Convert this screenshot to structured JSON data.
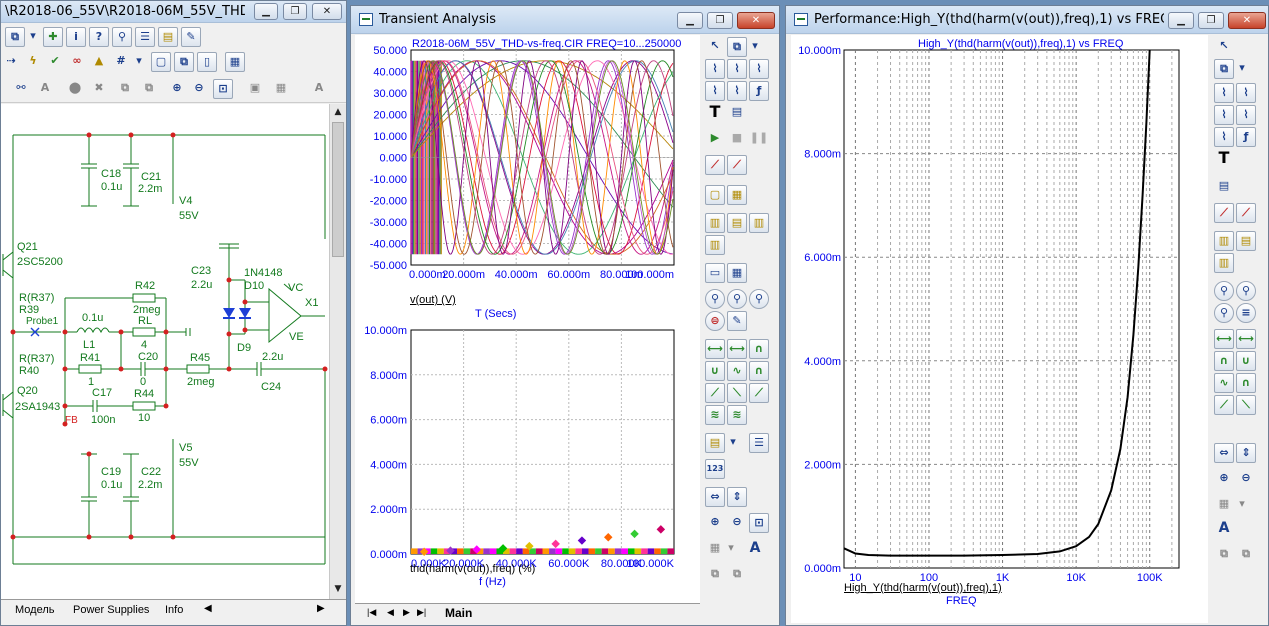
{
  "schematic": {
    "title": "\\R2018-06_55V\\R2018-06M_55V_THD-vs-fr...",
    "tabs": [
      "Модель",
      "Power Supplies",
      "Info"
    ],
    "labels": {
      "c18": "C18",
      "c18v": "0.1u",
      "c21": "C21",
      "c21v": "2.2m",
      "v4": "V4",
      "v4v": "55V",
      "q21": "Q21",
      "q21v": "2SC5200",
      "r42": "R42",
      "r42v": "2meg",
      "c23": "C23",
      "c23v": "2.2u",
      "d10n": "1N4148",
      "d10": "D10",
      "vc": "VC",
      "x1": "X1",
      "r37a": "R(R37)",
      "r39": "R39",
      "probe": "Probe1",
      "l1v": "0.1u",
      "l1": "L1",
      "rl": "RL",
      "rlv": "4",
      "d9": "D9",
      "ve": "VE",
      "r37b": "R(R37)",
      "r40": "R40",
      "r41": "R41",
      "r41v": "1",
      "c20": "C20",
      "c20v": "0",
      "r45": "R45",
      "r45v": "2meg",
      "c24v": "2.2u",
      "c24": "C24",
      "q20": "Q20",
      "q20v": "2SA1943",
      "c17": "C17",
      "c17v": "100n",
      "r44": "R44",
      "r44v": "10",
      "fb": "FB",
      "v5": "V5",
      "v5v": "55V",
      "c19": "C19",
      "c19v": "0.1u",
      "c22": "C22",
      "c22v": "2.2m"
    }
  },
  "transient": {
    "title": "Transient Analysis",
    "tab": "Main",
    "top_plot": {
      "heading": "R2018-06M_55V_THD-vs-freq.CIR FREQ=10...250000",
      "yticks": [
        "50.000",
        "40.000",
        "30.000",
        "20.000",
        "10.000",
        "0.000",
        "-10.000",
        "-20.000",
        "-30.000",
        "-40.000",
        "-50.000"
      ],
      "xticks": [
        "0.000m",
        "20.000m",
        "40.000m",
        "60.000m",
        "80.000m",
        "100.000m"
      ],
      "ylabel": "v(out) (V)",
      "xlabel": "T (Secs)"
    },
    "bottom_plot": {
      "yticks": [
        "10.000m",
        "8.000m",
        "6.000m",
        "4.000m",
        "2.000m",
        "0.000m"
      ],
      "xticks": [
        "0.000K",
        "20.000K",
        "40.000K",
        "60.000K",
        "80.000K",
        "100.000K"
      ],
      "ylabel": "thd(harm(v(out)),freq) (%)",
      "xlabel": "f (Hz)"
    }
  },
  "performance": {
    "title": "Performance:High_Y(thd(harm(v(out)),freq),1) vs FREQ",
    "heading": "High_Y(thd(harm(v(out)),freq),1) vs FREQ",
    "yticks": [
      "10.000m",
      "8.000m",
      "6.000m",
      "4.000m",
      "2.000m",
      "0.000m"
    ],
    "xticks": [
      "10",
      "100",
      "1K",
      "10K",
      "100K"
    ],
    "ylabel": "High_Y(thd(harm(v(out)),freq),1)",
    "xlabel": "FREQ"
  },
  "chart_data": [
    {
      "type": "line",
      "title": "R2018-06M_55V_THD-vs-freq.CIR FREQ=10...250000",
      "xlabel": "T (Secs)",
      "ylabel": "v(out) (V)",
      "xlim": [
        0,
        100
      ],
      "ylim": [
        -50,
        50
      ],
      "x_unit": "m",
      "series_note": "",
      "series": [
        {
          "freq_hz": 10,
          "amplitude": 45
        },
        {
          "freq_hz": 20,
          "amplitude": 45
        },
        {
          "freq_hz": 30,
          "amplitude": 45
        },
        {
          "freq_hz": 40,
          "amplitude": 45
        },
        {
          "freq_hz": 50,
          "amplitude": 45
        }
      ]
    },
    {
      "type": "scatter",
      "xlabel": "f (Hz)",
      "ylabel": "thd(harm(v(out)),freq) (%)",
      "xlim": [
        0,
        100
      ],
      "x_unit": "K",
      "ylim": [
        0,
        10
      ],
      "y_unit": "m",
      "points": [
        [
          5,
          0.1
        ],
        [
          15,
          0.15
        ],
        [
          25,
          0.2
        ],
        [
          35,
          0.25
        ],
        [
          45,
          0.35
        ],
        [
          55,
          0.45
        ],
        [
          65,
          0.6
        ],
        [
          75,
          0.75
        ],
        [
          85,
          0.9
        ],
        [
          95,
          1.1
        ]
      ]
    },
    {
      "type": "line",
      "title": "High_Y(thd(harm(v(out)),freq),1) vs FREQ",
      "xlabel": "FREQ",
      "ylabel": "High_Y(thd(harm(v(out)),freq),1)",
      "xscale": "log",
      "xlim": [
        7,
        250000
      ],
      "ylim": [
        0,
        10
      ],
      "y_unit": "m",
      "x": [
        7,
        10,
        15,
        30,
        100,
        300,
        1000,
        3000,
        6000,
        10000,
        15000,
        20000,
        30000,
        40000,
        50000,
        60000,
        70000,
        80000,
        90000,
        100000
      ],
      "y": [
        0.38,
        0.28,
        0.25,
        0.24,
        0.24,
        0.24,
        0.25,
        0.27,
        0.32,
        0.42,
        0.6,
        0.85,
        1.5,
        2.3,
        3.3,
        4.5,
        5.8,
        7.2,
        8.6,
        10.0
      ]
    }
  ]
}
